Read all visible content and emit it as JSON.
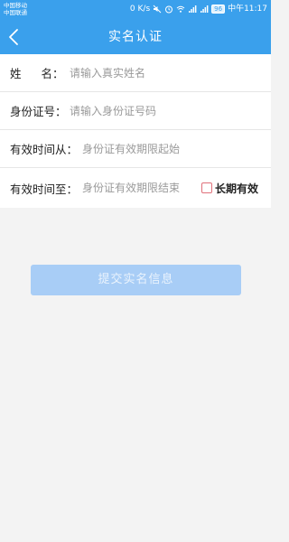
{
  "status_bar": {
    "carrier_1": "中国移动",
    "carrier_2": "中国联通",
    "net_speed": "0 K/s",
    "battery": "96",
    "time": "中午11:17"
  },
  "header": {
    "title": "实名认证",
    "back_icon": "chevron-left-icon"
  },
  "form": {
    "name": {
      "label_1": "姓",
      "label_2": "名：",
      "placeholder": "请输入真实姓名"
    },
    "id_number": {
      "label": "身份证号：",
      "placeholder": "请输入身份证号码"
    },
    "valid_from": {
      "label": "有效时间从：",
      "placeholder": "身份证有效期限起始"
    },
    "valid_to": {
      "label": "有效时间至：",
      "placeholder": "身份证有效期限结束"
    },
    "long_term": {
      "label": "长期有效",
      "checked": false
    }
  },
  "submit": {
    "label": "提交实名信息"
  },
  "colors": {
    "primary": "#3aa0ec",
    "submit_disabled": "#a8cdf6",
    "background": "#f3f3f3",
    "checkbox_border": "#e0707a"
  }
}
